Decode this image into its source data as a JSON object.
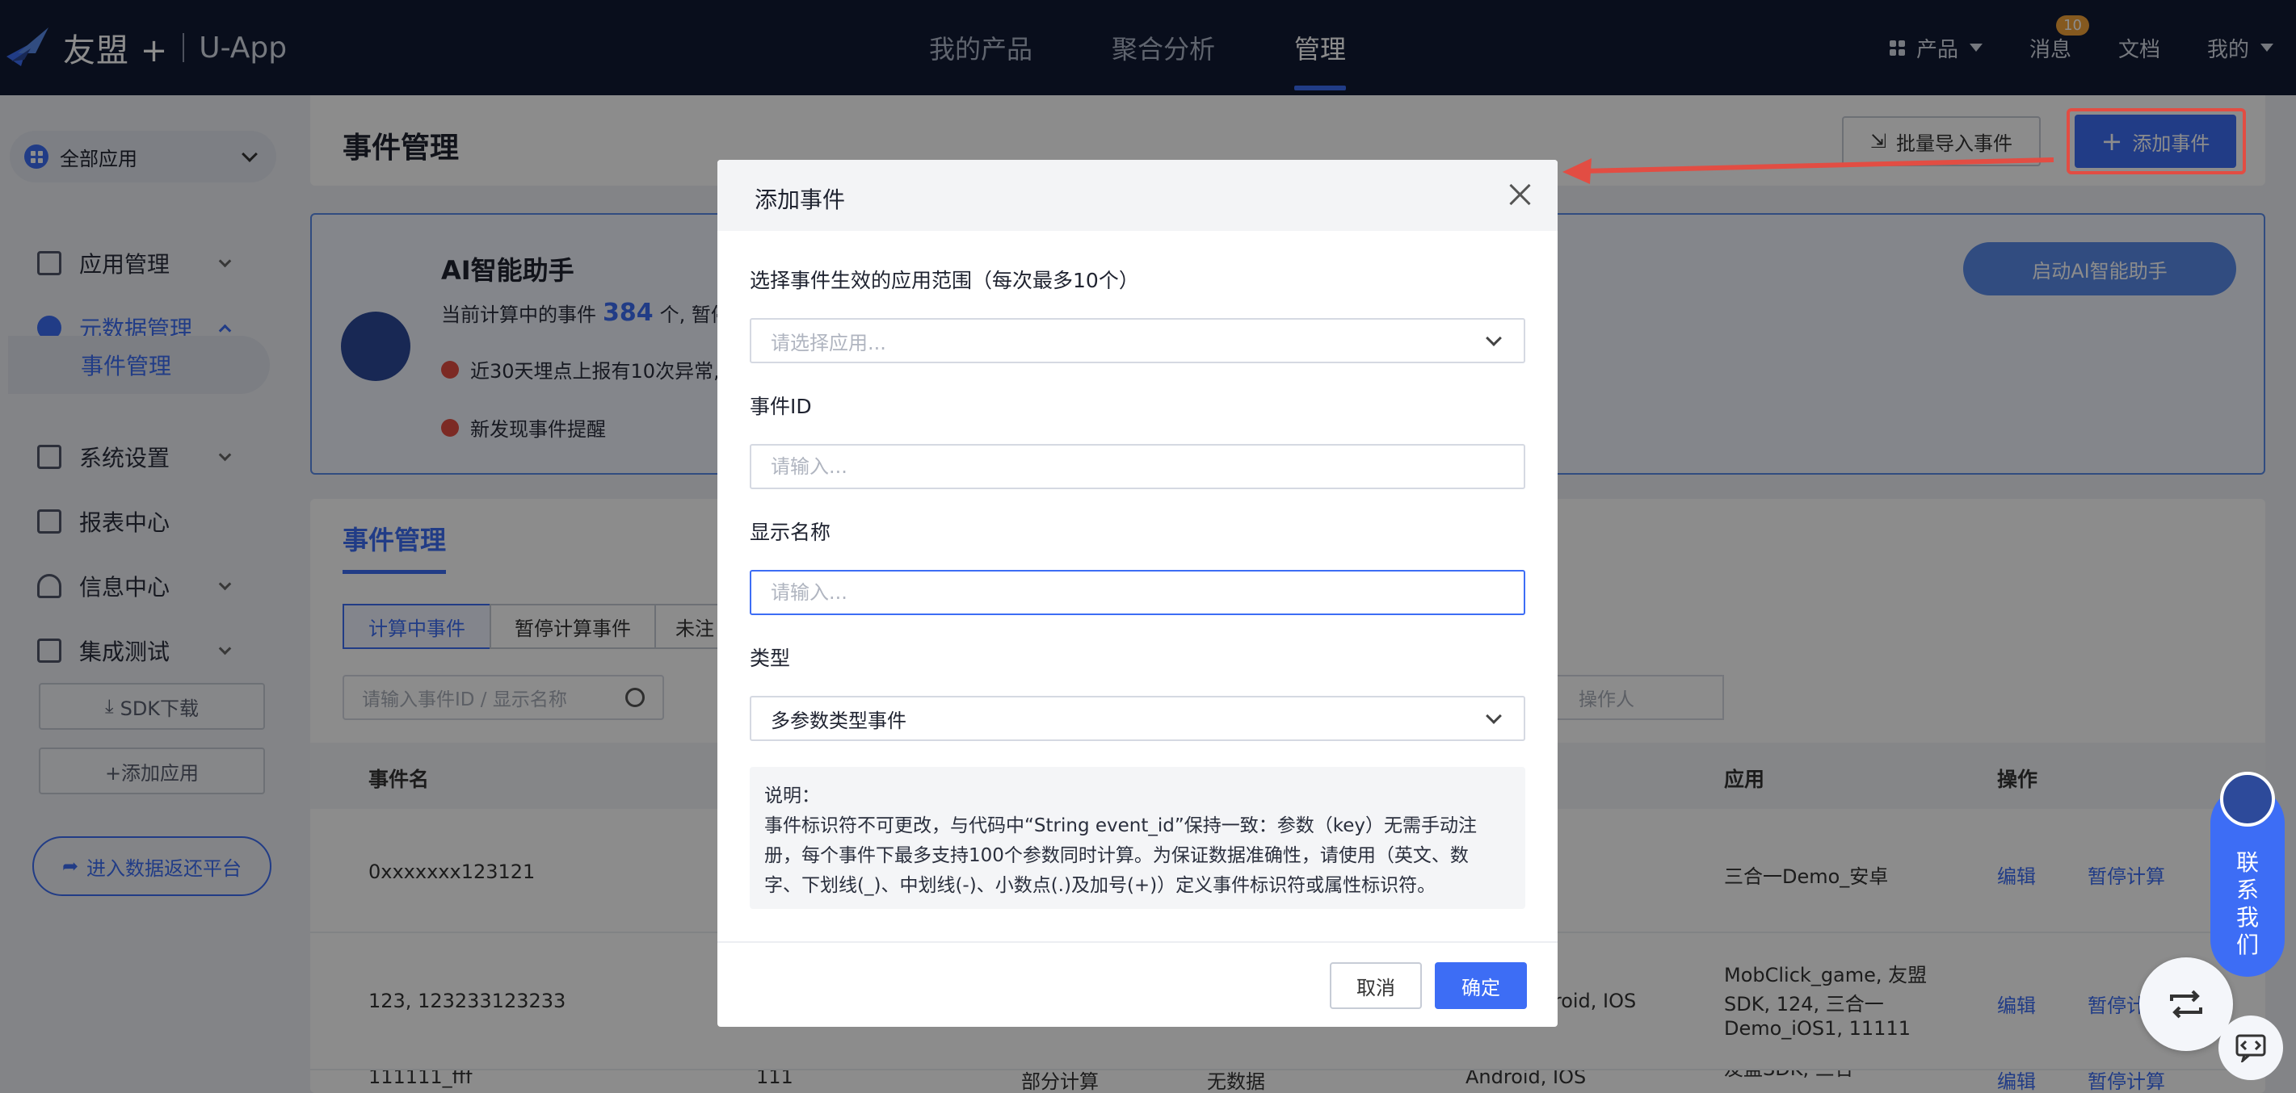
{
  "topbar": {
    "brand": "友盟 +",
    "product": "U-App",
    "tabs": [
      {
        "label": "我的产品"
      },
      {
        "label": "聚合分析"
      },
      {
        "label": "管理"
      }
    ],
    "products_label": "产品",
    "messages_label": "消息",
    "messages_badge": "10",
    "docs_label": "文档",
    "mine_label": "我的"
  },
  "sidebar": {
    "app_select": "全部应用",
    "items": [
      {
        "label": "应用管理"
      },
      {
        "label": "元数据管理"
      },
      {
        "label": "系统设置"
      },
      {
        "label": "报表中心"
      },
      {
        "label": "信息中心"
      },
      {
        "label": "集成测试"
      }
    ],
    "sub_active": "事件管理",
    "sdk_btn": "SDK下载",
    "add_app_btn": "+添加应用",
    "portal_btn": "进入数据返还平台"
  },
  "page": {
    "title": "事件管理",
    "import_btn": "批量导入事件",
    "add_btn": "添加事件"
  },
  "ai": {
    "title": "AI智能助手",
    "line1_prefix": "当前计算中的事件",
    "count": "384",
    "line1_suffix": "个, 暂停",
    "line2": "近30天埋点上报有10次异常,",
    "line3": "新发现事件提醒",
    "start_btn": "启动AI智能助手"
  },
  "list": {
    "title": "事件管理",
    "segments": [
      "计算中事件",
      "暂停计算事件",
      "未注"
    ],
    "search_placeholder": "请输入事件ID / 显示名称",
    "operator_placeholder": "操作人",
    "headers": {
      "name": "事件名",
      "app": "应用",
      "ops": "操作"
    },
    "rows": [
      {
        "name": "0xxxxxxx123121",
        "app": "三合一Demo_安卓",
        "edit": "编辑",
        "pause": "暂停计算",
        "mid": "",
        "platform": ""
      },
      {
        "name": "123, 123233123233",
        "app_lines": [
          "MobClick_game, 友盟",
          "SDK, 124, 三合一",
          "Demo_iOS1, 11111"
        ],
        "platform": "Android, IOS",
        "edit": "编辑",
        "pause": "暂停计算"
      },
      {
        "name": "111111_fff",
        "id": "111",
        "status": "部分计算",
        "data": "无数据",
        "platform": "Android, IOS",
        "app_lines": [
          "友盟SDK, 三合一"
        ],
        "edit": "编辑",
        "pause": "暂停计算"
      }
    ]
  },
  "modal": {
    "title": "添加事件",
    "scope_label": "选择事件生效的应用范围（每次最多10个）",
    "scope_placeholder": "请选择应用...",
    "id_label": "事件ID",
    "id_placeholder": "请输入...",
    "name_label": "显示名称",
    "name_placeholder": "请输入...",
    "type_label": "类型",
    "type_value": "多参数类型事件",
    "note_title": "说明：",
    "note_line1": "事件标识符不可更改，与代码中“String event_id”保持一致：参数（key）无需手动注",
    "note_line2": "册，每个事件下最多支持100个参数同时计算。为保证数据准确性，请使用（英文、数",
    "note_line3": "字、下划线(_)、中划线(-)、小数点(.)及加号(+)）定义事件标识符或属性标识符。",
    "cancel_btn": "取消",
    "ok_btn": "确定"
  },
  "float": {
    "contact": [
      "联",
      "系",
      "我",
      "们"
    ]
  },
  "colors": {
    "topbar": "#121a33",
    "accent": "#3d6df5",
    "highlight": "#e24d43"
  }
}
